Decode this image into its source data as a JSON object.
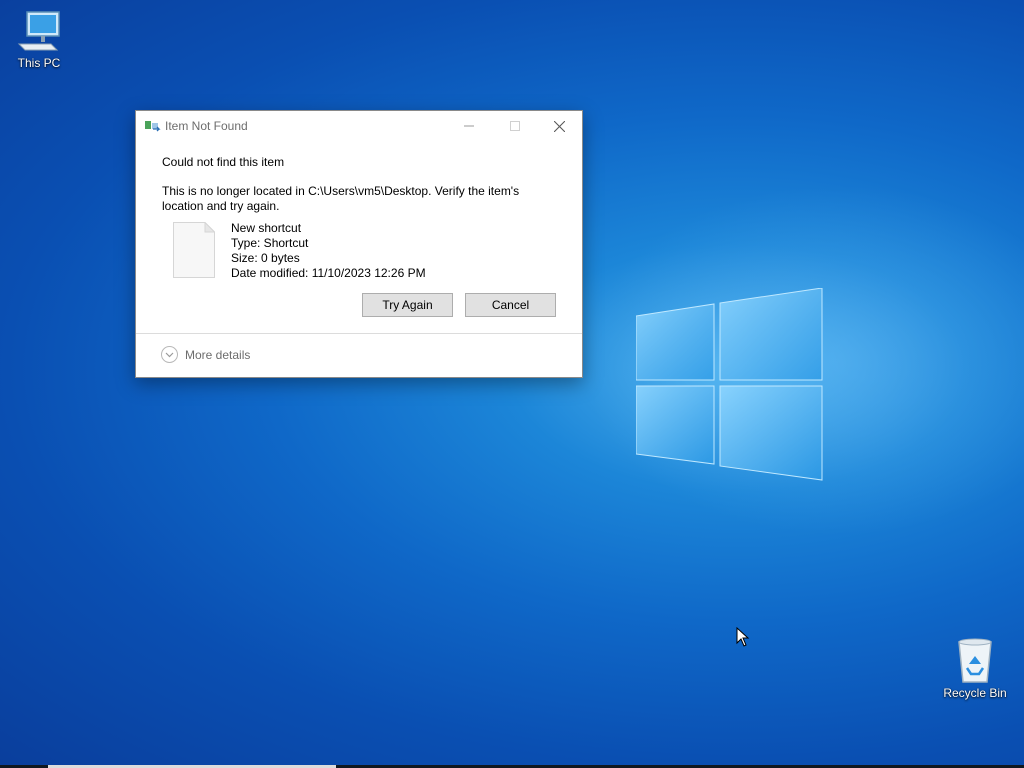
{
  "desktop": {
    "icons": [
      {
        "label": "This PC",
        "icon": "computer-icon"
      },
      {
        "label": "Recycle Bin",
        "icon": "recycle-bin-icon"
      }
    ]
  },
  "dialog": {
    "title": "Item Not Found",
    "heading": "Could not find this item",
    "message": "This is no longer located in C:\\Users\\vm5\\Desktop. Verify the item's location and try again.",
    "file": {
      "name": "New shortcut",
      "type": "Type: Shortcut",
      "size": "Size: 0 bytes",
      "modified": "Date modified: 11/10/2023 12:26 PM"
    },
    "buttons": {
      "try_again": "Try Again",
      "cancel": "Cancel"
    },
    "more_details": "More details"
  },
  "colors": {
    "desktop_accent": "#0f68c8",
    "button_bg": "#e1e1e1",
    "title_text": "#6d6d6d"
  }
}
